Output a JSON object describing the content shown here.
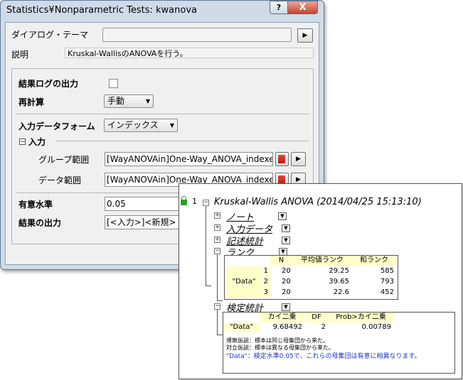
{
  "dialog": {
    "title": "Statistics¥Nonparametric Tests: kwanova",
    "help_label": "?",
    "close_label": "X",
    "theme_label": "ダイアログ・テーマ",
    "theme_value": "",
    "theme_arrow": "▶",
    "desc_label": "説明",
    "desc_value": "Kruskal-WallisのANOVAを行う。",
    "log_label": "結果ログの出力",
    "log_checked": false,
    "recalc_label": "再計算",
    "recalc_value": "手動",
    "input_form_label": "入力データフォーム",
    "input_form_value": "インデックス",
    "input_section_label": "入力",
    "group_range_label": "グループ範囲",
    "group_range_value": "[WayANOVAin]One-Way_ANOVA_indexed!B",
    "data_range_label": "データ範囲",
    "data_range_value": "[WayANOVAin]One-Way_ANOVA_indexed!C",
    "sig_label": "有意水準",
    "sig_value": "0.05",
    "output_label": "結果の出力",
    "output_value": "[<入力>]<新規>"
  },
  "report": {
    "row_index": "1",
    "title": "Kruskal-Wallis ANOVA (2014/04/25 15:13:10)",
    "nodes": {
      "notes": "ノート",
      "input_data": "入力データ",
      "desc_stats": "記述統計",
      "rank": "ランク",
      "test_stats": "検定統計"
    },
    "rank_table": {
      "headers": [
        "N",
        "平均値ランク",
        "和ランク"
      ],
      "group_label": "\"Data\"",
      "rows": [
        {
          "idx": "1",
          "n": "20",
          "mean": "29.25",
          "sum": "585"
        },
        {
          "idx": "2",
          "n": "20",
          "mean": "39.65",
          "sum": "793"
        },
        {
          "idx": "3",
          "n": "20",
          "mean": "22.6",
          "sum": "452"
        }
      ]
    },
    "test_table": {
      "headers": [
        "カイ二乗",
        "DF",
        "Prob>カイ二乗"
      ],
      "label": "\"Data\"",
      "chi": "9.68492",
      "df": "2",
      "prob": "0.00789"
    },
    "notes": {
      "null": "帰無仮説：標本は同じ母集団から来た。",
      "alt": "対立仮説：標本は異なる母集団から来た。",
      "conclusion": "\"Data\"：検定水準0.05で、これらの母集団は有意に相異なります。"
    },
    "colors": {
      "header_fill": "#ffffc8",
      "conclusion_text": "#1f35c0"
    }
  }
}
